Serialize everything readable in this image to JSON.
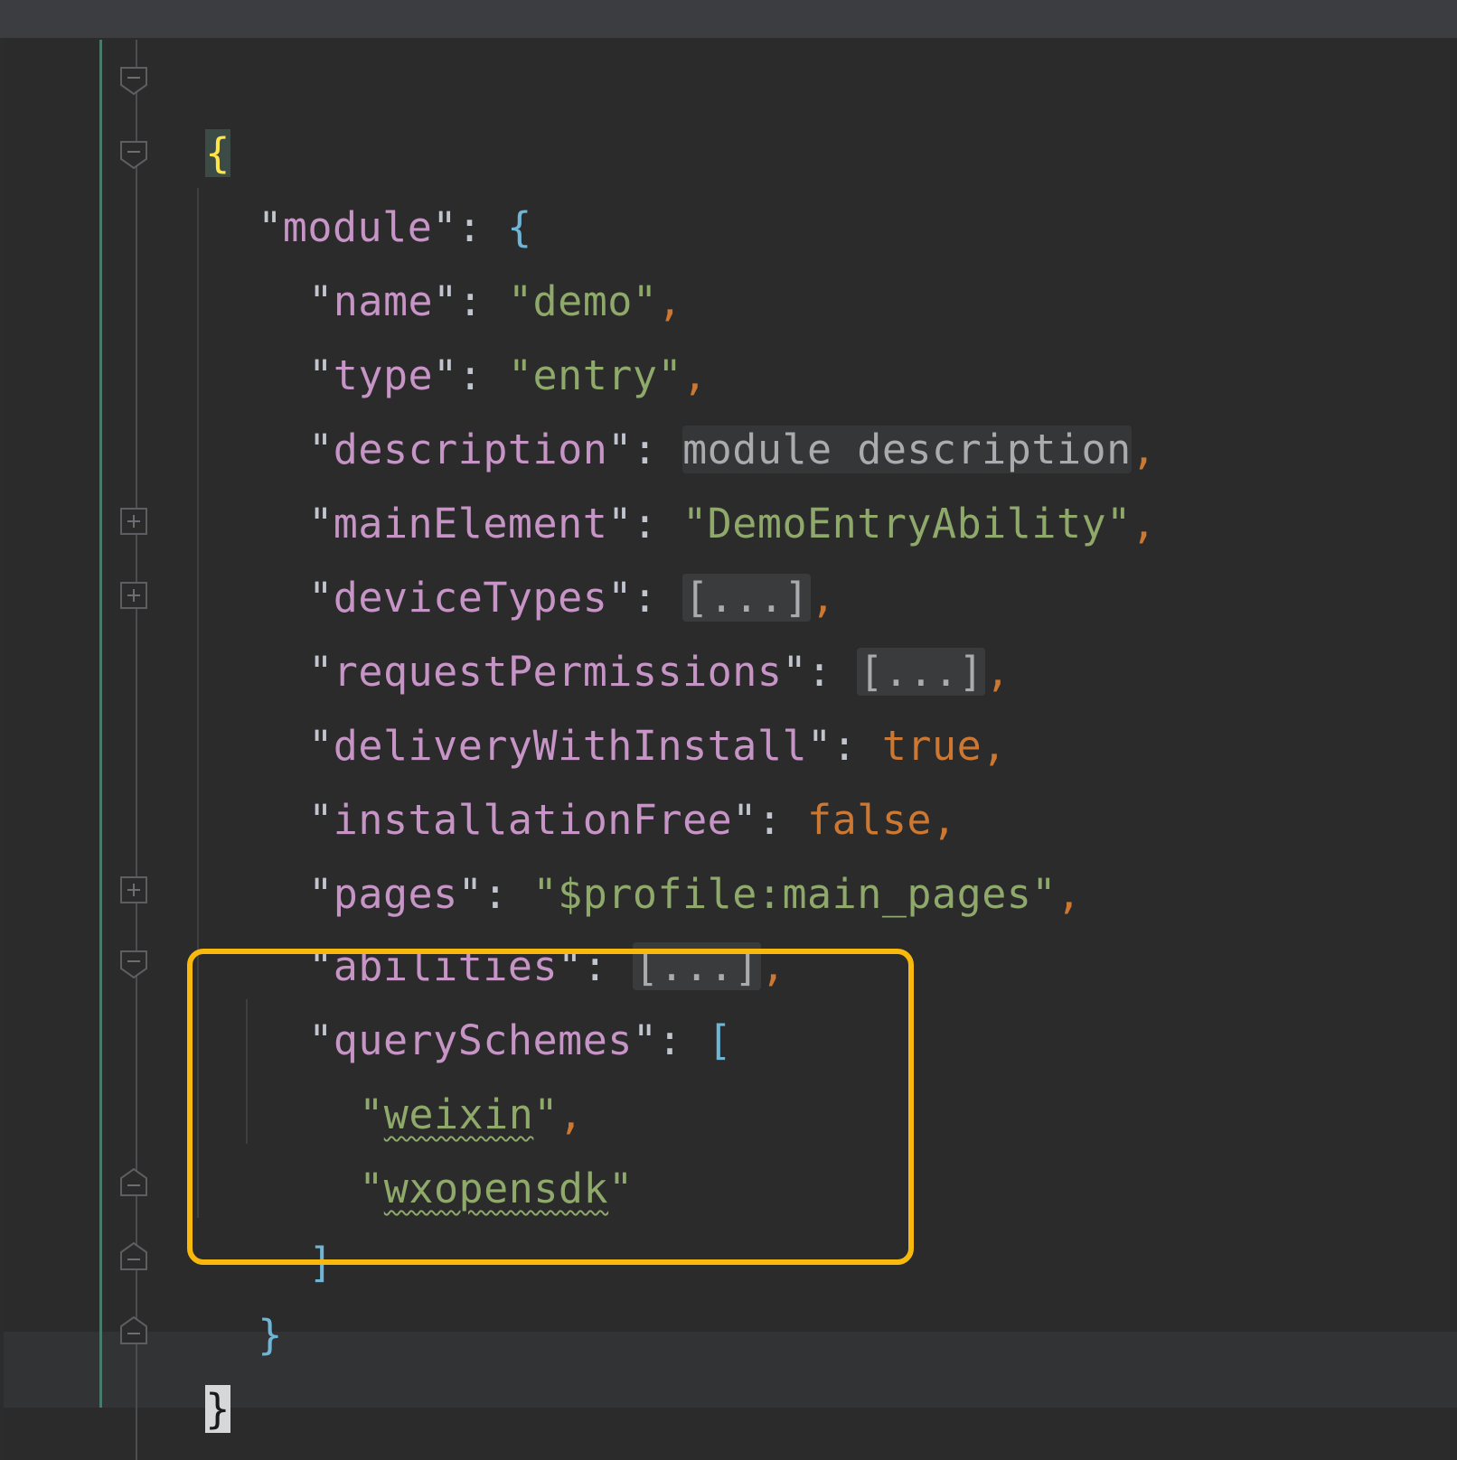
{
  "editor": {
    "language": "json",
    "highlight_color": "#f9b90c",
    "lines": [
      {
        "text": "{"
      },
      {
        "key": "module",
        "open": "{"
      },
      {
        "key": "name",
        "value": "demo"
      },
      {
        "key": "type",
        "value": "entry"
      },
      {
        "key": "description",
        "placeholder": "module description"
      },
      {
        "key": "mainElement",
        "value": "DemoEntryAbility"
      },
      {
        "key": "deviceTypes",
        "folded": "[...]"
      },
      {
        "key": "requestPermissions",
        "folded": "[...]"
      },
      {
        "key": "deliveryWithInstall",
        "literal": "true"
      },
      {
        "key": "installationFree",
        "literal": "false"
      },
      {
        "key": "pages",
        "value": "$profile:main_pages"
      },
      {
        "key": "abilities",
        "folded": "[...]"
      },
      {
        "key": "querySchemes",
        "open": "["
      },
      {
        "value": "weixin"
      },
      {
        "value": "wxopensdk"
      },
      {
        "text": "]"
      },
      {
        "text": "}"
      },
      {
        "text": "}"
      }
    ]
  }
}
